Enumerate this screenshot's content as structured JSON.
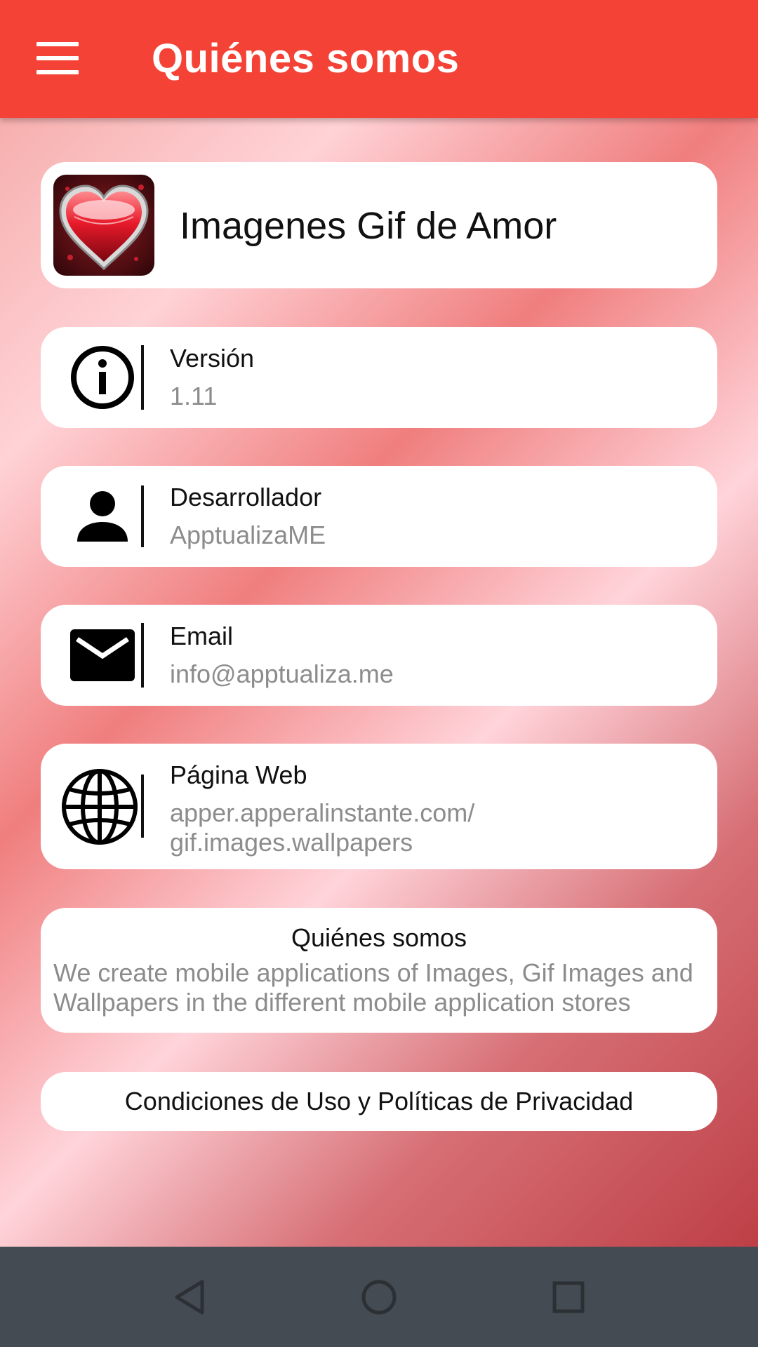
{
  "appbar": {
    "menu_icon": "hamburger-menu-icon",
    "title": "Quiénes somos"
  },
  "app": {
    "icon": "heart-app-icon",
    "name": "Imagenes Gif de Amor"
  },
  "info": [
    {
      "icon": "info-icon",
      "label": "Versión",
      "value": "1.11"
    },
    {
      "icon": "person-icon",
      "label": "Desarrollador",
      "value": "ApptualizaME"
    },
    {
      "icon": "mail-icon",
      "label": "Email",
      "value": "info@apptualiza.me"
    },
    {
      "icon": "globe-icon",
      "label": "Página Web",
      "value_line1": "apper.apperalinstante.com/",
      "value_line2": "gif.images.wallpapers"
    }
  ],
  "about": {
    "title": "Quiénes somos",
    "text": "We create mobile applications of Images, Gif Images and Wallpapers in the different mobile application stores"
  },
  "terms": {
    "label": "Condiciones de Uso y Políticas de Privacidad"
  },
  "navbar": {
    "back_icon": "back-triangle-icon",
    "home_icon": "home-circle-icon",
    "recents_icon": "recents-square-icon"
  },
  "colors": {
    "appbar": "#f44336",
    "navbar": "#444b52",
    "card": "#ffffff",
    "secondary_text": "#8c8c8c"
  }
}
